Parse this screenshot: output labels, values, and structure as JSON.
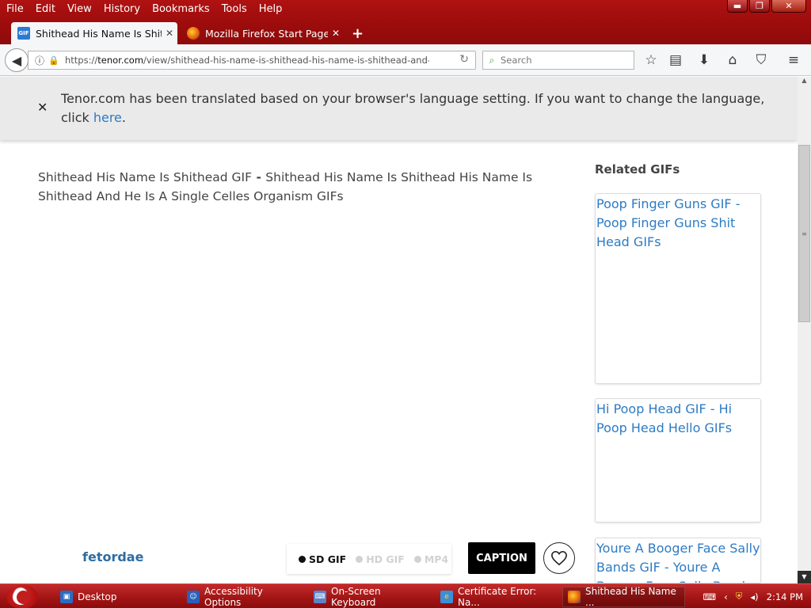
{
  "menu": {
    "items": [
      "File",
      "Edit",
      "View",
      "History",
      "Bookmarks",
      "Tools",
      "Help"
    ]
  },
  "window_controls": {
    "minimize": "▬",
    "restore": "❐",
    "close": "✕"
  },
  "tabs": [
    {
      "favicon": "GIF",
      "title": "Shithead His Name Is Shith..."
    },
    {
      "title": "Mozilla Firefox Start Page"
    }
  ],
  "nav": {
    "url_prefix": "https://",
    "url_domain": "tenor.com",
    "url_path": "/view/shithead-his-name-is-shithead-his-name-is-shithead-and-he-",
    "search_placeholder": "Search"
  },
  "notice": {
    "text": "Tenor.com has been translated based on your browser's language setting. If you want to change the language, click",
    "link": "here",
    "period": "."
  },
  "gif": {
    "title_part1": "Shithead His Name Is Shithead GIF",
    "separator": " - ",
    "title_part2": "Shithead His Name Is Shithead His Name Is Shithead And He Is A Single Celles Organism GIFs",
    "author": "fetordae"
  },
  "related": {
    "heading": "Related GIFs",
    "cards": [
      {
        "title": "Poop Finger Guns GIF - Poop Finger Guns Shit Head GIFs"
      },
      {
        "title": "Hi Poop Head GIF - Hi Poop Head Hello GIFs"
      },
      {
        "title": "Youre A Booger Face Sally Bands GIF - Youre A Booger Face Sally Bands"
      }
    ]
  },
  "formats": {
    "sd": "SD GIF",
    "hd": "HD GIF",
    "mp4": "MP4"
  },
  "actions": {
    "caption": "CAPTION"
  },
  "taskbar": {
    "items": [
      {
        "label": "Desktop",
        "icon": "desktop-icon"
      },
      {
        "label": "Accessibility Options",
        "icon": "accessibility-icon"
      },
      {
        "label": "On-Screen Keyboard",
        "icon": "keyboard-icon"
      },
      {
        "label": "Certificate Error: Na...",
        "icon": "ie-icon"
      },
      {
        "label": "Shithead His Name ...",
        "icon": "firefox-icon"
      }
    ],
    "clock": "2:14 PM"
  },
  "colors": {
    "chrome_red": "#a00d0d",
    "link_blue": "#2d7bc4",
    "author_blue": "#2d6da3"
  }
}
